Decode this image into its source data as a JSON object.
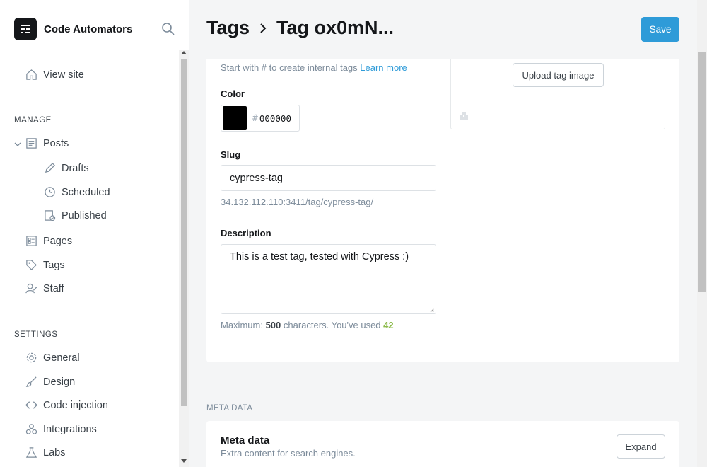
{
  "brand": {
    "name": "Code Automators"
  },
  "sidebar": {
    "view_site": "View site",
    "manage_label": "MANAGE",
    "posts": "Posts",
    "drafts": "Drafts",
    "scheduled": "Scheduled",
    "published": "Published",
    "pages": "Pages",
    "tags": "Tags",
    "staff": "Staff",
    "settings_label": "SETTINGS",
    "general": "General",
    "design": "Design",
    "code_injection": "Code injection",
    "integrations": "Integrations",
    "labs": "Labs"
  },
  "header": {
    "crumb_parent": "Tags",
    "crumb_current": "Tag ox0mN...",
    "save_label": "Save"
  },
  "form": {
    "hint_text": "Start with # to create internal tags",
    "hint_link": "Learn more",
    "color_label": "Color",
    "color_hash": "#",
    "color_value": "000000",
    "slug_label": "Slug",
    "slug_value": "cypress-tag",
    "slug_url": "34.132.112.110:3411/tag/cypress-tag/",
    "description_label": "Description",
    "description_value": "This is a test tag, tested with Cypress :)",
    "counter_prefix": "Maximum:",
    "counter_max": "500",
    "counter_mid": "characters. You've used",
    "counter_used": "42",
    "upload_label": "Upload tag image"
  },
  "meta": {
    "section_heading": "META DATA",
    "title": "Meta data",
    "subtitle": "Extra content for search engines.",
    "expand_label": "Expand"
  },
  "colors": {
    "accent": "#2e9bd8",
    "swatch": "#000000",
    "used_count": "#8cba4a"
  }
}
